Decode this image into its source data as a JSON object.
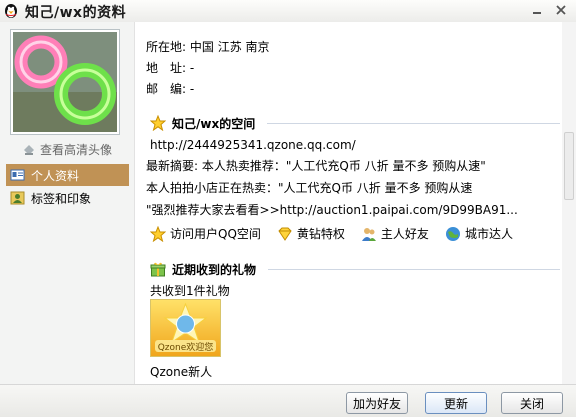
{
  "window": {
    "title": "知己/wx的资料",
    "icon": "qq-penguin-icon"
  },
  "sidebar": {
    "hd_link": "查看高清头像",
    "items": [
      {
        "label": "个人资料",
        "icon": "profile-card-icon",
        "active": true
      },
      {
        "label": "标签和印象",
        "icon": "user-tags-icon",
        "active": false
      }
    ]
  },
  "profile": {
    "location_label": "所在地:",
    "location_value": "中国 江苏 南京",
    "address_label": "地　址:",
    "address_value": "-",
    "postcode_label": "邮　编:",
    "postcode_value": "-"
  },
  "qzone": {
    "title": "知己/wx的空间",
    "url": "http://2444925341.qzone.qq.com/",
    "summary": "最新摘要: 本人热卖推荐：\"人工代充Q币 八折 量不多 预购从速\"",
    "paipai_line": "本人拍拍小店正在热卖：\"人工代充Q币 八折 量不多 预购从速",
    "auction_line": "\"强烈推荐大家去看看>>http://auction1.paipai.com/9D99BA91...",
    "links": [
      {
        "label": "访问用户QQ空间",
        "icon": "star-icon"
      },
      {
        "label": "黄钻特权",
        "icon": "yellow-diamond-icon"
      },
      {
        "label": "主人好友",
        "icon": "friends-icon"
      },
      {
        "label": "城市达人",
        "icon": "globe-icon"
      }
    ]
  },
  "gifts": {
    "title": "近期收到的礼物",
    "count_text": "共收到1件礼物",
    "gift_name": "Qzone新人",
    "gift_badge": "Qzone欢迎您"
  },
  "buttons": {
    "add_friend": "加为好友",
    "update": "更新",
    "close": "关闭"
  },
  "colors": {
    "active_nav": "#c09255",
    "section_rule": "#cfd7e3"
  }
}
